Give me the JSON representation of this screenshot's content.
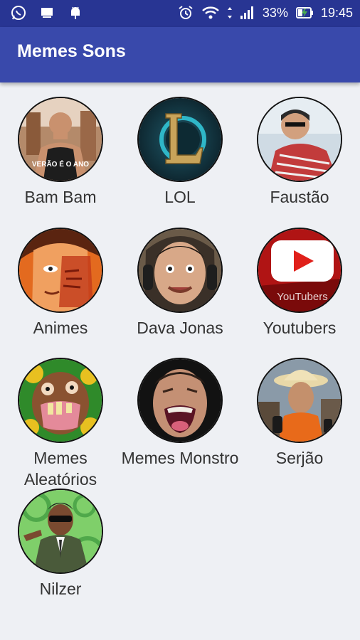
{
  "status_bar": {
    "battery": "33%",
    "time": "19:45"
  },
  "app_bar": {
    "title": "Memes Sons"
  },
  "categories": [
    {
      "label": "Bam Bam",
      "caption": "VERÃO É O ANO"
    },
    {
      "label": "LOL"
    },
    {
      "label": "Faustão"
    },
    {
      "label": "Animes"
    },
    {
      "label": "Dava Jonas"
    },
    {
      "label": "Youtubers",
      "caption": "YouTubers"
    },
    {
      "label": "Memes Aleatórios"
    },
    {
      "label": "Memes Monstro"
    },
    {
      "label": "Serjão"
    },
    {
      "label": "Nilzer"
    }
  ],
  "colors": {
    "status_bar": "#283593",
    "app_bar": "#3949ab",
    "background": "#eef0f4"
  }
}
